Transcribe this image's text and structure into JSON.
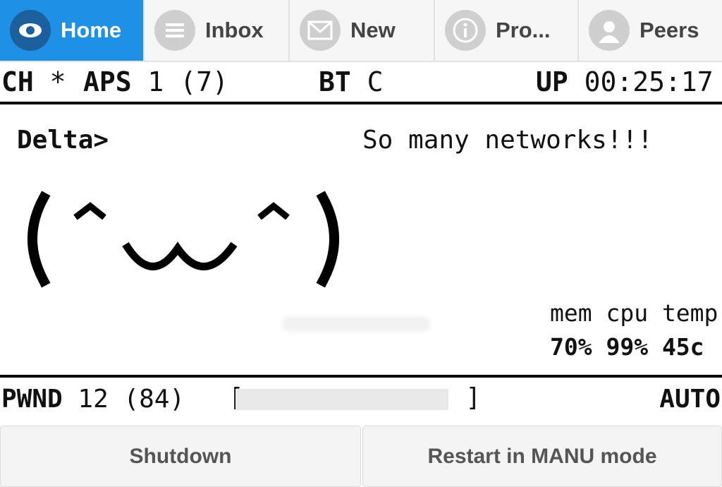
{
  "tabs": [
    {
      "label": "Home",
      "icon": "eye-icon",
      "active": true
    },
    {
      "label": "Inbox",
      "icon": "list-icon",
      "active": false
    },
    {
      "label": "New",
      "icon": "envelope-icon",
      "active": false
    },
    {
      "label": "Pro...",
      "icon": "info-icon",
      "active": false
    },
    {
      "label": "Peers",
      "icon": "person-icon",
      "active": false
    }
  ],
  "status_top": {
    "ch_label": "CH",
    "ch_value": "*",
    "aps_label": "APS",
    "aps_value": "1 (7)",
    "bt_label": "BT",
    "bt_value": "C",
    "up_label": "UP",
    "up_value": "00:25:17"
  },
  "main": {
    "name": "Delta>",
    "message": "So many networks!!!",
    "face": "(^‿‿^)",
    "stats": {
      "headers": "mem cpu temp",
      "values": "70% 99%  45c"
    }
  },
  "status_bottom": {
    "pwnd_label": "PWND",
    "pwnd_value": "12 (84)",
    "progress": 0.9,
    "mode": "AUTO"
  },
  "buttons": {
    "shutdown": "Shutdown",
    "restart": "Restart in MANU mode"
  },
  "colors": {
    "accent": "#1e90e6",
    "accent_dark": "#1b5f9c"
  }
}
